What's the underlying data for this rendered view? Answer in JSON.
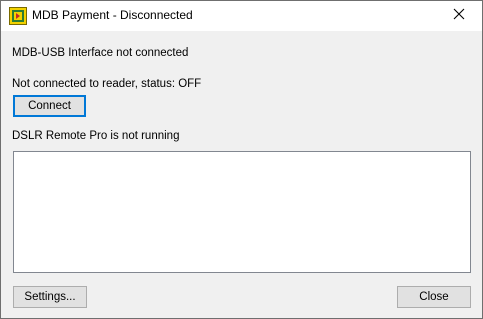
{
  "window": {
    "title": "MDB Payment - Disconnected",
    "icon": "app-icon",
    "close_icon": "close-icon"
  },
  "status": {
    "interface": "MDB-USB Interface not connected",
    "reader": "Not connected to reader, status: OFF",
    "dslr": "DSLR Remote Pro is not running"
  },
  "buttons": {
    "connect": "Connect",
    "settings": "Settings...",
    "close": "Close"
  },
  "log": {
    "text": ""
  },
  "colors": {
    "focus_accent": "#0078d7",
    "dialog_bg": "#f0f0f0",
    "button_bg": "#e1e1e1"
  }
}
